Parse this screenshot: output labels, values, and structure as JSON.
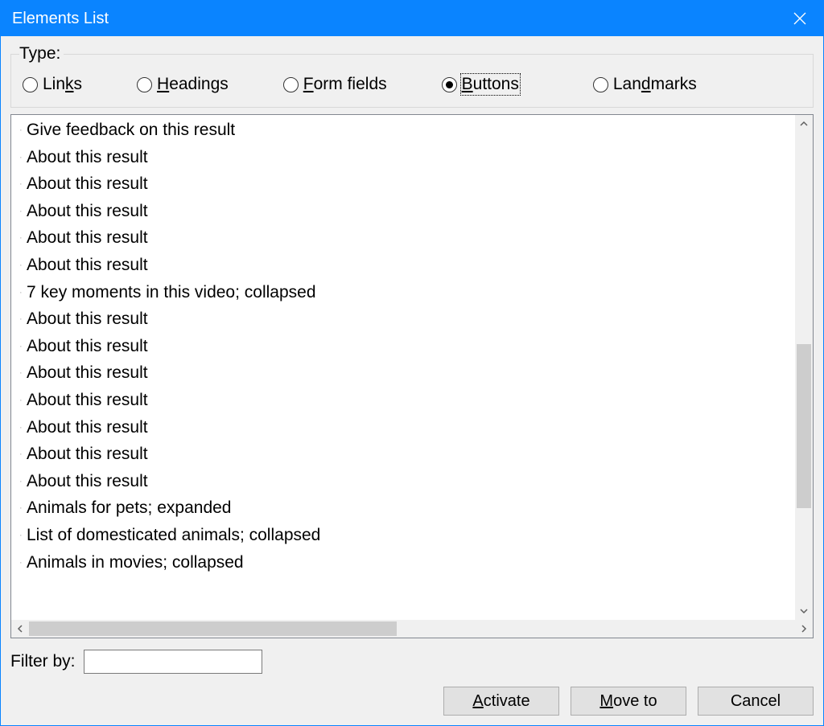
{
  "window": {
    "title": "Elements List"
  },
  "type_group": {
    "legend": "Type:",
    "options": {
      "links": {
        "pre": "Lin",
        "hot": "k",
        "post": "s",
        "selected": false
      },
      "headings": {
        "pre": "",
        "hot": "H",
        "post": "eadings",
        "selected": false
      },
      "formfields": {
        "pre": "",
        "hot": "F",
        "post": "orm fields",
        "selected": false
      },
      "buttons": {
        "pre": "",
        "hot": "B",
        "post": "uttons",
        "selected": true
      },
      "landmarks": {
        "pre": "Lan",
        "hot": "d",
        "post": "marks",
        "selected": false
      }
    }
  },
  "list": {
    "items": [
      "Give feedback on this result",
      "About this result",
      "About this result",
      "About this result",
      "About this result",
      "About this result",
      "7 key moments in this video; collapsed",
      "About this result",
      "About this result",
      "About this result",
      "About this result",
      "About this result",
      "About this result",
      "About this result",
      "Animals for pets; expanded",
      "List of domesticated animals; collapsed",
      "Animals in movies; collapsed"
    ]
  },
  "filter": {
    "label": "Filter by:",
    "value": ""
  },
  "buttons": {
    "activate": {
      "pre": "",
      "hot": "A",
      "post": "ctivate"
    },
    "moveto": {
      "pre": "",
      "hot": "M",
      "post": "ove to"
    },
    "cancel": {
      "pre": "Cancel",
      "hot": "",
      "post": ""
    }
  }
}
